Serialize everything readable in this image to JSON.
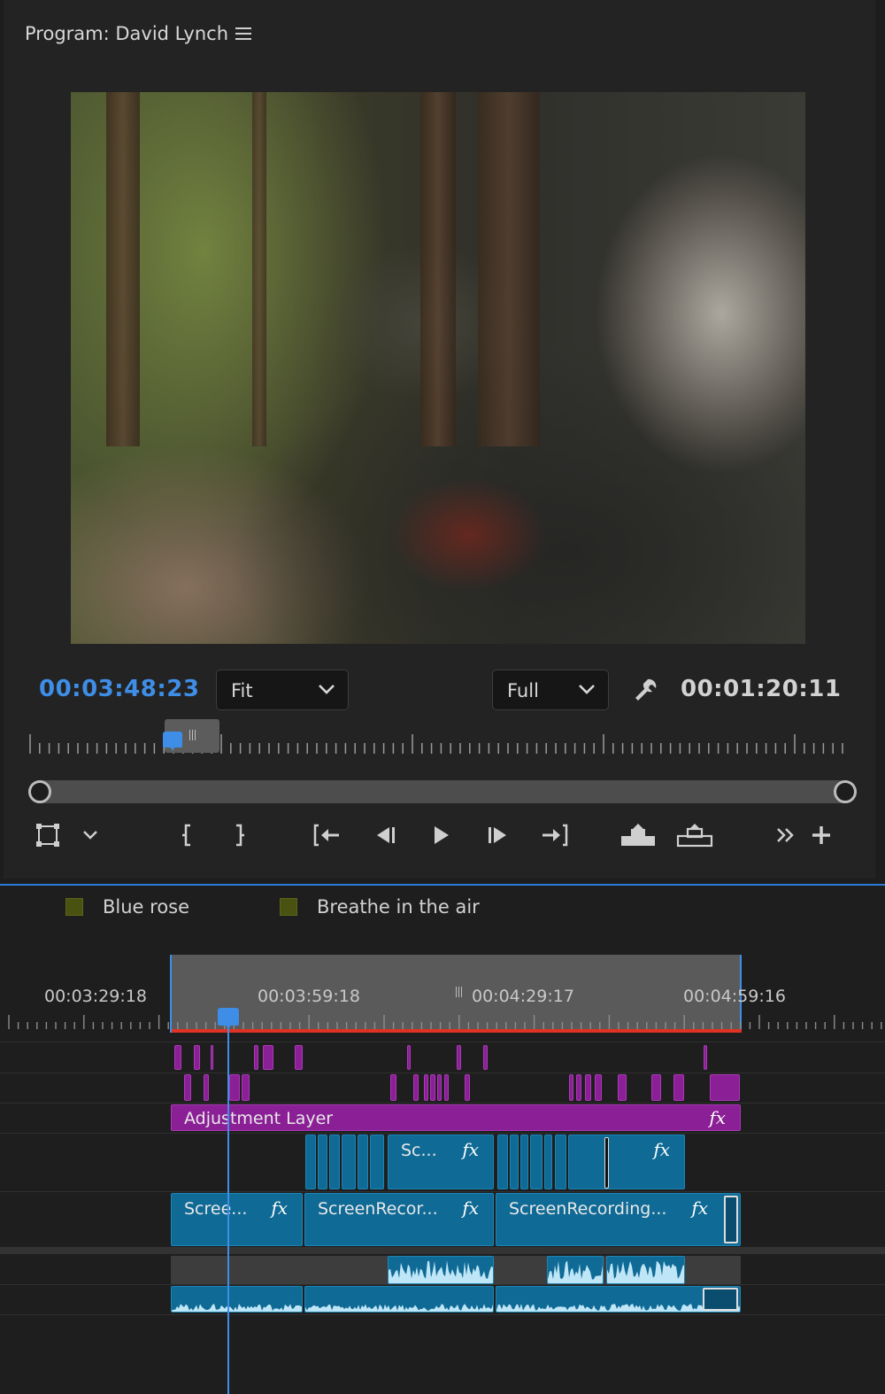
{
  "monitor": {
    "title": "Program: David Lynch",
    "current_timecode": "00:03:48:23",
    "duration_timecode": "00:01:20:11",
    "zoom": {
      "selected": "Fit"
    },
    "resolution": {
      "selected": "Full"
    }
  },
  "controls": {
    "icons": [
      "safe-margins-icon",
      "button-settings-chevron-icon",
      "mark-in-icon",
      "mark-out-icon",
      "go-to-in-icon",
      "step-back-icon",
      "play-icon",
      "step-forward-icon",
      "go-to-out-icon",
      "lift-icon",
      "extract-icon",
      "more-icon",
      "add-button-icon"
    ]
  },
  "timeline": {
    "markers": [
      {
        "label": "Blue rose",
        "color": "#4a5212"
      },
      {
        "label": "Breathe in the air",
        "color": "#4a5212"
      }
    ],
    "ruler_labels": [
      "00:03:29:18",
      "00:03:59:18",
      "00:04:29:17",
      "00:04:59:16"
    ],
    "clips": {
      "adjustment_layer": "Adjustment Layer",
      "v2_short": "Sc...",
      "v1_a": "Scree...",
      "v1_b": "ScreenRecor...",
      "v1_c": "ScreenRecording..."
    },
    "fx_label": "fx",
    "colors": {
      "accent": "#3e8ee8",
      "work_area_bar": "#e03224",
      "purple_clip": "#8a1f96",
      "blue_clip": "#0f6a95"
    }
  }
}
